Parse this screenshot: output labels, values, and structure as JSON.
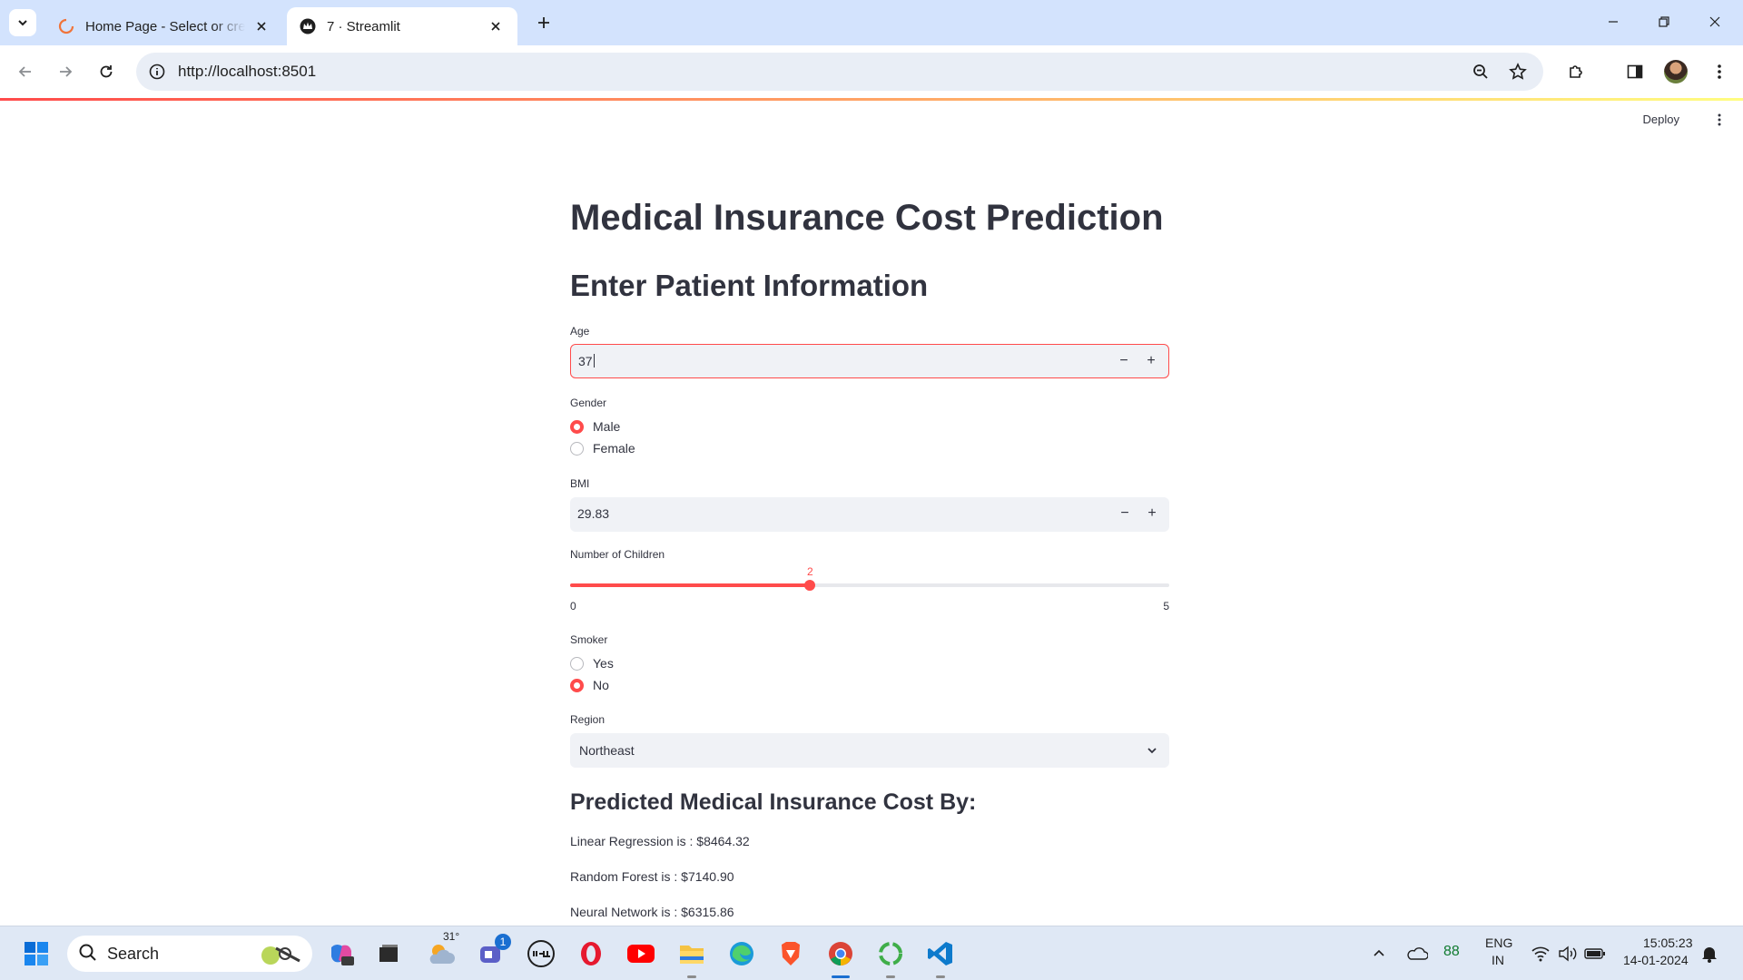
{
  "browser": {
    "tabs": [
      {
        "title": "Home Page - Select or create",
        "active": false
      },
      {
        "title": "7 · Streamlit",
        "active": true
      }
    ],
    "url": "http://localhost:8501"
  },
  "streamlit": {
    "deploy_label": "Deploy"
  },
  "app": {
    "title": "Medical Insurance Cost Prediction",
    "section_title": "Enter Patient Information",
    "age": {
      "label": "Age",
      "value": "37",
      "minus": "−",
      "plus": "+"
    },
    "gender": {
      "label": "Gender",
      "options": [
        "Male",
        "Female"
      ],
      "selected": "Male"
    },
    "bmi": {
      "label": "BMI",
      "value": "29.83",
      "minus": "−",
      "plus": "+"
    },
    "children": {
      "label": "Number of Children",
      "value": 2,
      "value_text": "2",
      "min": 0,
      "max": 5,
      "min_text": "0",
      "max_text": "5"
    },
    "smoker": {
      "label": "Smoker",
      "options": [
        "Yes",
        "No"
      ],
      "selected": "No"
    },
    "region": {
      "label": "Region",
      "value": "Northeast"
    },
    "results_title": "Predicted Medical Insurance Cost By:",
    "predictions": [
      "Linear Regression is : $8464.32",
      "Random Forest is : $7140.90",
      "Neural Network is : $6315.86"
    ],
    "accent_color": "#ff4b4b"
  },
  "taskbar": {
    "search_placeholder": "Search",
    "weather_temp": "31°",
    "teams_badge": "1",
    "battery_percent": "88",
    "language_line1": "ENG",
    "language_line2": "IN",
    "time": "15:05:23",
    "date": "14-01-2024"
  }
}
